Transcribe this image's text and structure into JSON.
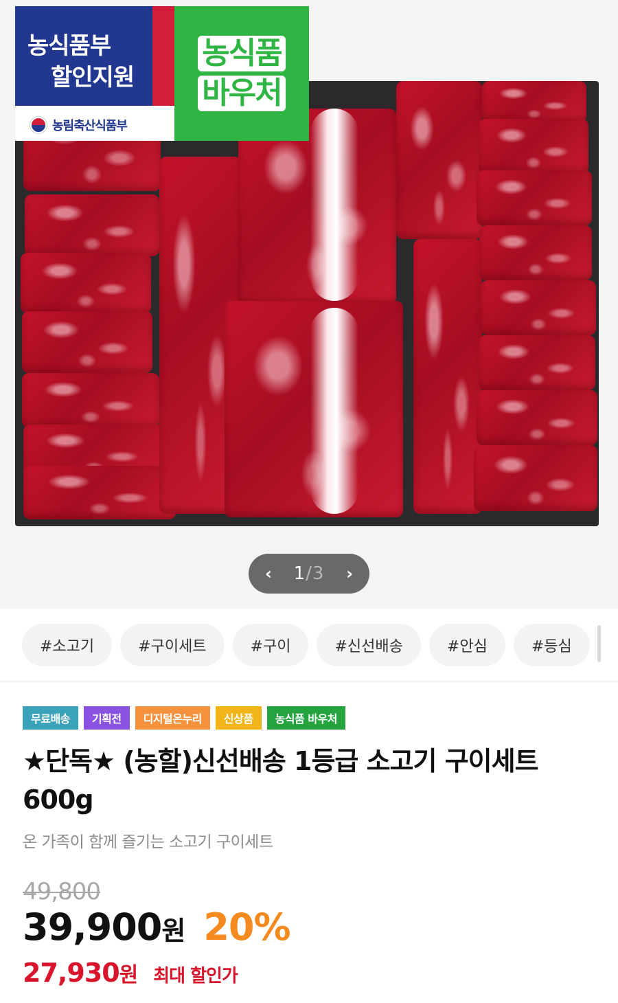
{
  "hero": {
    "badge_left": {
      "line1": "농식품부",
      "line2": "할인지원",
      "ministry": "농림축산식품부"
    },
    "badge_right": {
      "line1": "농식품",
      "line2": "바우처"
    },
    "pager": {
      "prev": "‹",
      "current": "1",
      "separator": "/",
      "total": "3",
      "next": "›"
    }
  },
  "hashtags": [
    "#소고기",
    "#구이세트",
    "#구이",
    "#신선배송",
    "#안심",
    "#등심"
  ],
  "labels": [
    {
      "text": "무료배송",
      "color": "#3aa3ba"
    },
    {
      "text": "기획전",
      "color": "#8a52e0"
    },
    {
      "text": "디지털온누리",
      "color": "#f5923e"
    },
    {
      "text": "신상품",
      "color": "#f2b519"
    },
    {
      "text": "농식품 바우처",
      "color": "#24a33f"
    }
  ],
  "product": {
    "title": "★단독★ (농할)신선배송 1등급 소고기 구이세트 600g",
    "subtitle": "온 가족이 함께 즐기는 소고기 구이세트",
    "original_price": "49,800",
    "price": "39,900",
    "currency": "원",
    "discount": "20%",
    "max_discount_price": "27,930",
    "max_discount_label": "최대 할인가"
  }
}
